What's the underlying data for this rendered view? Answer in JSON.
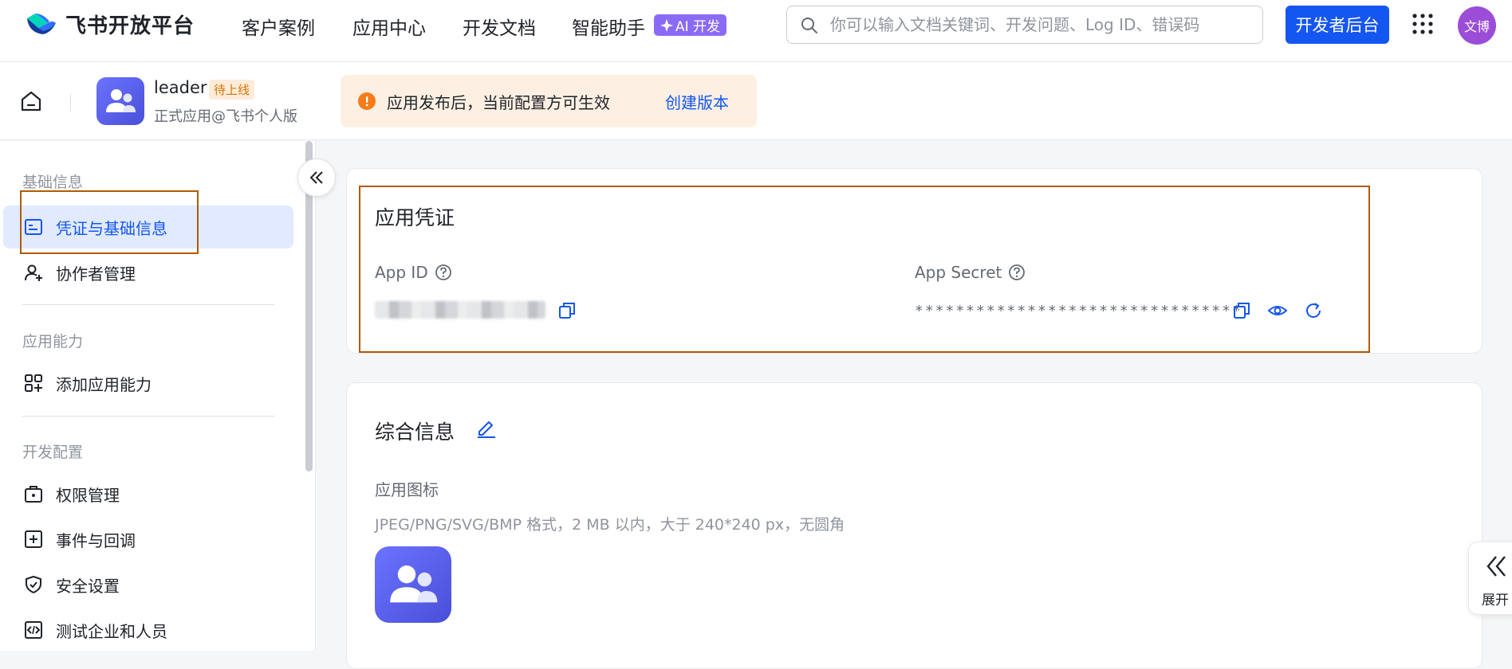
{
  "brand": {
    "name": "飞书开放平台"
  },
  "nav": {
    "links": [
      "客户案例",
      "应用中心",
      "开发文档",
      "智能助手"
    ],
    "ai_badge": "AI 开发",
    "search_placeholder": "你可以输入文档关键词、开发问题、Log ID、错误码",
    "dev_console": "开发者后台",
    "avatar_text": "文博"
  },
  "app": {
    "name": "leader",
    "status": "待上线",
    "subtitle": "正式应用@飞书个人版",
    "notice": "应用发布后，当前配置方可生效",
    "notice_link": "创建版本"
  },
  "sidebar": {
    "sections": [
      {
        "title": "基础信息",
        "items": [
          "凭证与基础信息",
          "协作者管理"
        ]
      },
      {
        "title": "应用能力",
        "items": [
          "添加应用能力"
        ]
      },
      {
        "title": "开发配置",
        "items": [
          "权限管理",
          "事件与回调",
          "安全设置",
          "测试企业和人员"
        ]
      }
    ],
    "active_item": "凭证与基础信息"
  },
  "credentials": {
    "title": "应用凭证",
    "app_id_label": "App ID",
    "app_secret_label": "App Secret",
    "app_secret_masked": "********************************"
  },
  "general_info": {
    "title": "综合信息",
    "icon_label": "应用图标",
    "icon_hint": "JPEG/PNG/SVG/BMP 格式，2 MB 以内，大于 240*240 px，无圆角"
  },
  "expand_panel": {
    "label": "展开"
  },
  "colors": {
    "primary": "#1456f0",
    "highlight_box": "#b25a00",
    "app_icon": "#5b5ff0"
  }
}
